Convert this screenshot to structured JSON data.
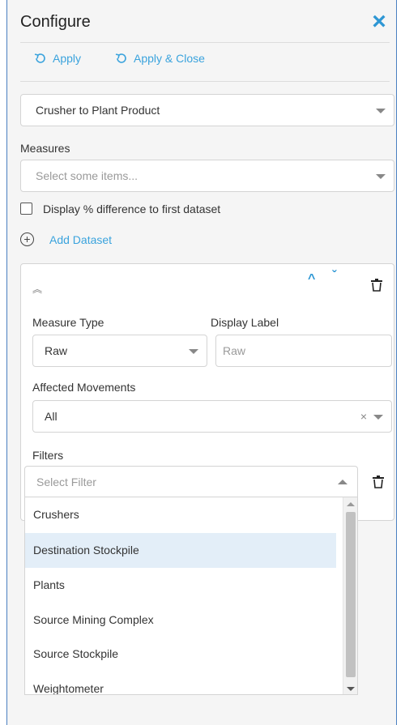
{
  "panel": {
    "title": "Configure",
    "close_icon": "close-icon"
  },
  "toolbar": {
    "apply_label": "Apply",
    "apply_close_label": "Apply & Close"
  },
  "dataset_select": {
    "value": "Crusher to Plant Product"
  },
  "measures": {
    "label": "Measures",
    "placeholder": "Select some items..."
  },
  "display_diff": {
    "label": "Display % difference to first dataset",
    "checked": false
  },
  "add_dataset": {
    "label": "Add Dataset"
  },
  "dataset_card": {
    "measure_type": {
      "label": "Measure Type",
      "value": "Raw"
    },
    "display_label": {
      "label": "Display Label",
      "placeholder": "Raw"
    },
    "affected_movements": {
      "label": "Affected Movements",
      "value": "All",
      "clear": "×"
    },
    "filters": {
      "label": "Filters",
      "placeholder": "Select Filter",
      "options": [
        "Crushers",
        "Destination Stockpile",
        "Plants",
        "Source Mining Complex",
        "Source Stockpile",
        "Weightometer"
      ],
      "highlighted": "Destination Stockpile"
    }
  },
  "colors": {
    "accent": "#2e97d4",
    "link": "#3aa3dd",
    "highlight": "#e3eef8"
  }
}
